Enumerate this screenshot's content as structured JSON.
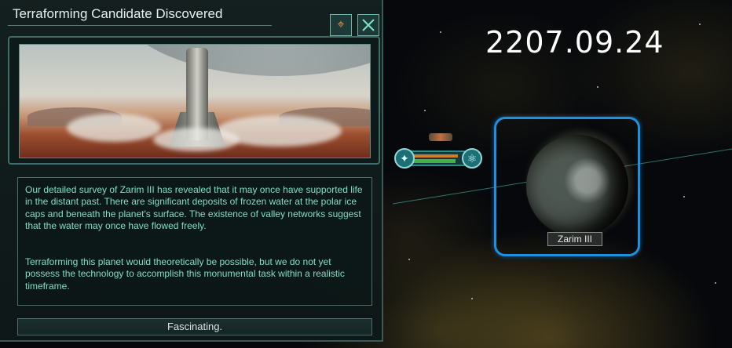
{
  "event_dialog": {
    "title": "Terraforming Candidate Discovered",
    "paragraph_1": "Our detailed survey of Zarim III has revealed that it may once have supported life in the distant past. There are significant deposits of frozen water at the polar ice caps and beneath the planet's surface. The existence of valley networks suggest that the water may once have flowed freely.",
    "paragraph_2": "Terraforming this planet would theoretically be possible, but we do not yet possess the technology to accomplish this monumental task within a realistic timeframe.",
    "button_label": "Fascinating.",
    "camera_icon": "camera-target-icon",
    "close_icon": "close-icon"
  },
  "game_date": "2207.09.24",
  "planet": {
    "name": "Zarim III"
  },
  "fleet": {
    "health_fraction": 0.9,
    "shield_fraction": 0.85
  },
  "colors": {
    "text_teal": "#7ce0c4",
    "selection_blue": "#1f8fe0"
  }
}
